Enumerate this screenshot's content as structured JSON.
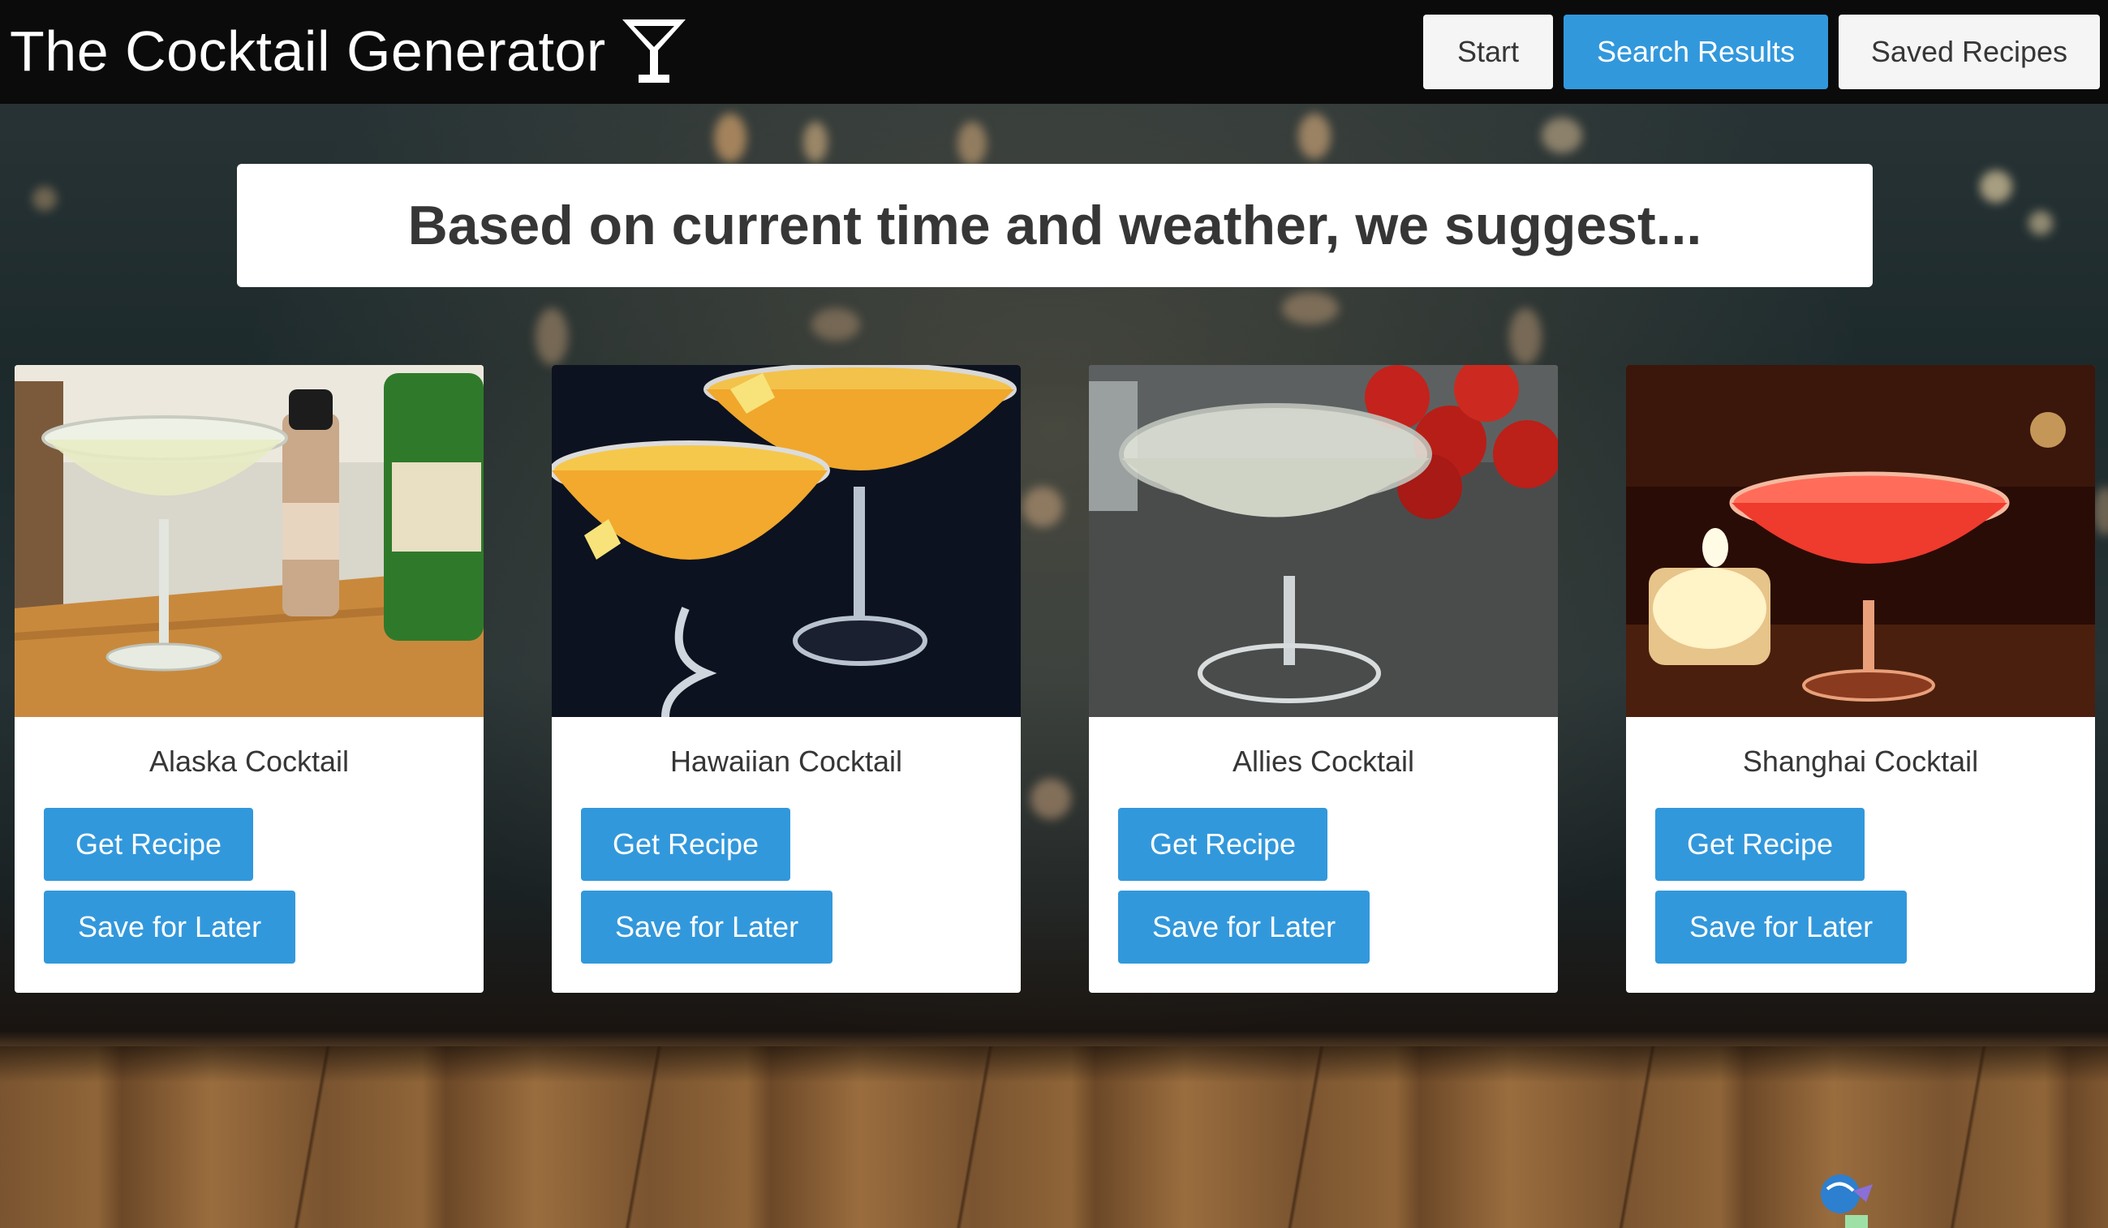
{
  "header": {
    "title": "The Cocktail Generator",
    "icon": "martini-glass-icon",
    "nav": [
      {
        "label": "Start",
        "active": false
      },
      {
        "label": "Search Results",
        "active": true
      },
      {
        "label": "Saved Recipes",
        "active": false
      }
    ]
  },
  "banner": {
    "text": "Based on current time and weather, we suggest..."
  },
  "cards": [
    {
      "title": "Alaska Cocktail",
      "recipe_label": "Get Recipe",
      "save_label": "Save for Later",
      "image": "alaska-cocktail-photo"
    },
    {
      "title": "Hawaiian Cocktail",
      "recipe_label": "Get Recipe",
      "save_label": "Save for Later",
      "image": "hawaiian-cocktail-photo"
    },
    {
      "title": "Allies Cocktail",
      "recipe_label": "Get Recipe",
      "save_label": "Save for Later",
      "image": "allies-cocktail-photo"
    },
    {
      "title": "Shanghai Cocktail",
      "recipe_label": "Get Recipe",
      "save_label": "Save for Later",
      "image": "shanghai-cocktail-photo"
    }
  ],
  "colors": {
    "primary": "#3298dc",
    "header_bg": "#0b0b0b",
    "light_button": "#f5f5f5",
    "text_dark": "#363636"
  }
}
